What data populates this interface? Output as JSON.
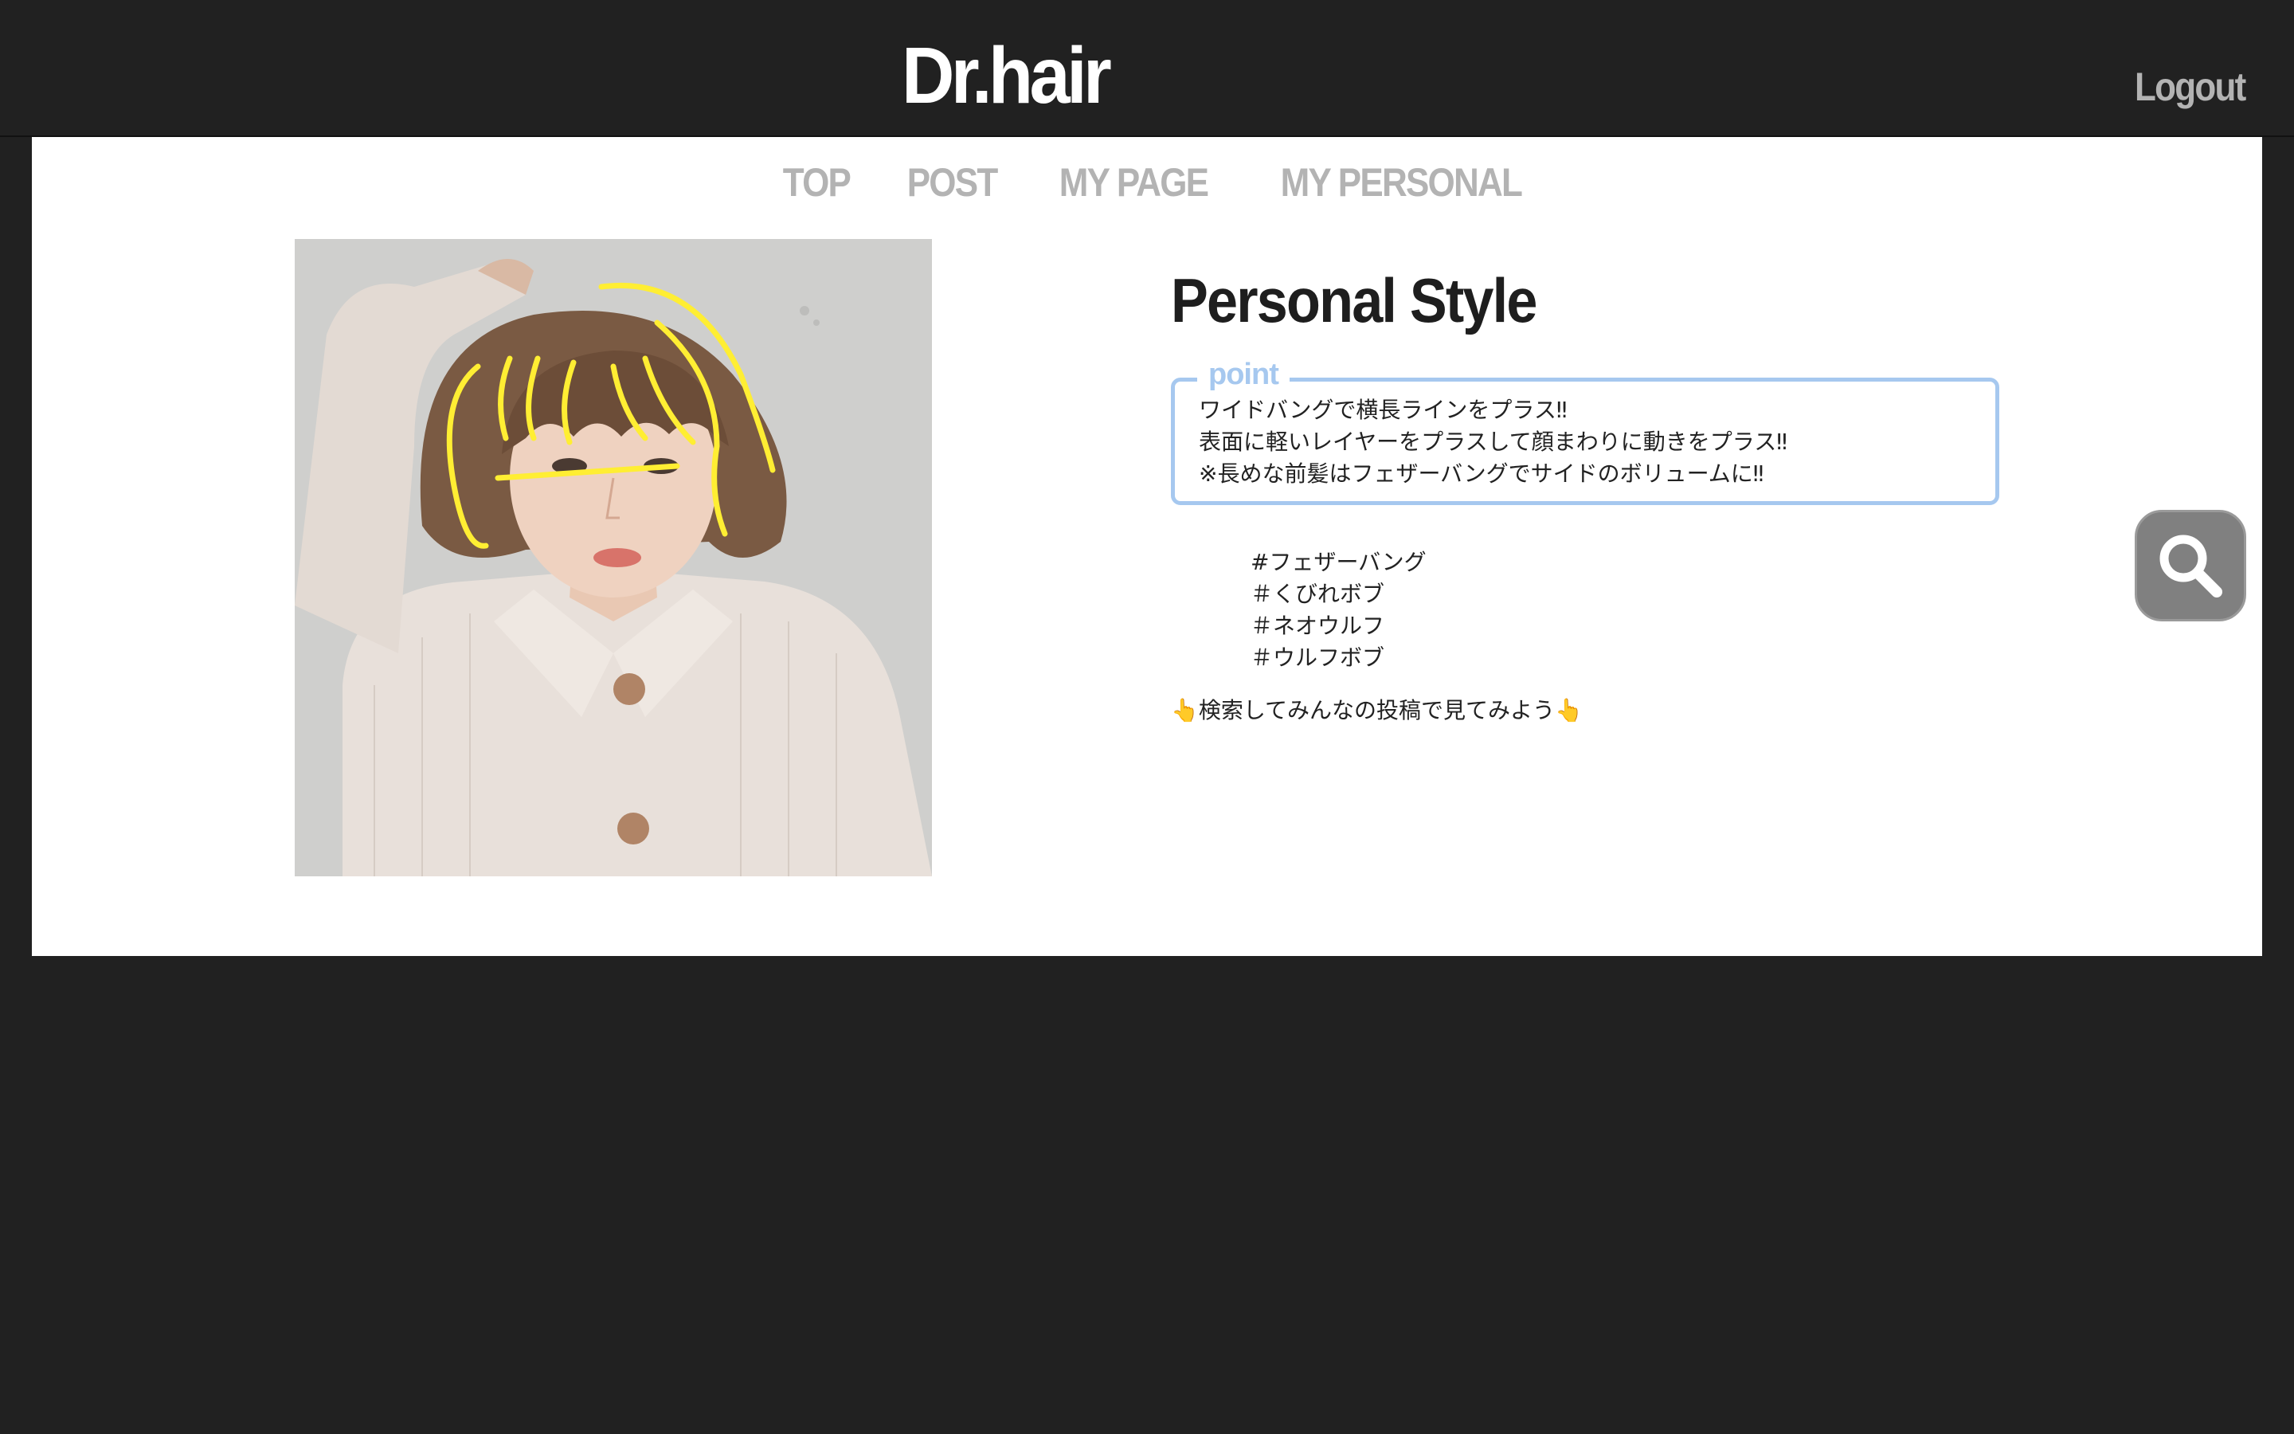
{
  "header": {
    "logo": "Dr.hair",
    "logout_label": "Logout"
  },
  "nav": {
    "items": [
      {
        "label": "TOP"
      },
      {
        "label": "POST"
      },
      {
        "label": "MY PAGE"
      },
      {
        "label": "MY PERSONAL"
      }
    ]
  },
  "main": {
    "photo_alt": "hair style photo",
    "title": "Personal Style",
    "point": {
      "label": "point",
      "lines": [
        "ワイドバングで横長ラインをプラス‼︎",
        "表面に軽いレイヤーをプラスして顔まわりに動きをプラス‼︎",
        "※長めな前髪はフェザーバングでサイドのボリュームに‼︎"
      ]
    },
    "tags": [
      "#フェザーバング",
      "＃くびれボブ",
      "＃ネオウルフ",
      "＃ウルフボブ"
    ],
    "cta": "👆検索してみんなの投稿で見てみよう👆"
  },
  "search_button": {
    "icon": "search-icon"
  },
  "colors": {
    "background": "#212121",
    "panel": "#ffffff",
    "nav_text": "#b3b3b3",
    "point_border": "#a6c8ef",
    "search_button": "#808080",
    "hair_guides": "#ffee33"
  }
}
